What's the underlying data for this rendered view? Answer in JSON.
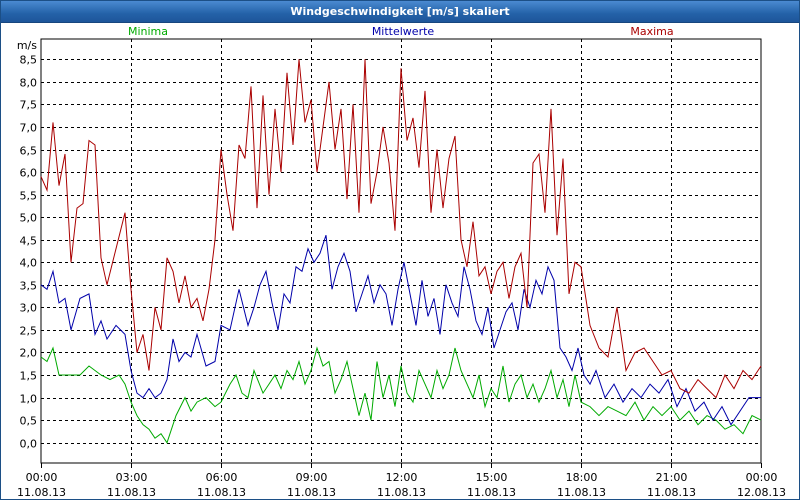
{
  "window": {
    "title": "Windgeschwindigkeit [m/s] skaliert"
  },
  "chart_data": {
    "type": "line",
    "title": "Windgeschwindigkeit [m/s] skaliert",
    "ylabel": "m/s",
    "ylim": [
      -0.45,
      8.95
    ],
    "yticks": [
      0.0,
      0.5,
      1.0,
      1.5,
      2.0,
      2.5,
      3.0,
      3.5,
      4.0,
      4.5,
      5.0,
      5.5,
      6.0,
      6.5,
      7.0,
      7.5,
      8.0,
      8.5
    ],
    "ytick_labels": [
      "0,0",
      "0,5",
      "1,0",
      "1,5",
      "2,0",
      "2,5",
      "3,0",
      "3,5",
      "4,0",
      "4,5",
      "5,0",
      "5,5",
      "6,0",
      "6,5",
      "7,0",
      "7,5",
      "8,0",
      "8,5"
    ],
    "xlim": [
      0,
      24
    ],
    "xticks": [
      0,
      3,
      6,
      9,
      12,
      15,
      18,
      21,
      24
    ],
    "xtick_labels": [
      [
        "00:00",
        "11.08.13"
      ],
      [
        "03:00",
        "11.08.13"
      ],
      [
        "06:00",
        "11.08.13"
      ],
      [
        "09:00",
        "11.08.13"
      ],
      [
        "12:00",
        "11.08.13"
      ],
      [
        "15:00",
        "11.08.13"
      ],
      [
        "18:00",
        "11.08.13"
      ],
      [
        "21:00",
        "11.08.13"
      ],
      [
        "00:00",
        "12.08.13"
      ]
    ],
    "grid": true,
    "legend": "top",
    "series": [
      {
        "name": "Minima",
        "color": "#00aa00",
        "x": [
          0.0,
          0.2,
          0.4,
          0.6,
          0.8,
          1.0,
          1.3,
          1.6,
          2.0,
          2.3,
          2.6,
          2.8,
          3.0,
          3.2,
          3.4,
          3.6,
          3.8,
          4.0,
          4.2,
          4.5,
          4.8,
          5.0,
          5.2,
          5.5,
          5.8,
          6.0,
          6.3,
          6.5,
          6.7,
          6.9,
          7.1,
          7.4,
          7.6,
          7.8,
          8.0,
          8.2,
          8.4,
          8.6,
          8.8,
          9.0,
          9.2,
          9.4,
          9.6,
          9.8,
          10.0,
          10.2,
          10.4,
          10.6,
          10.8,
          11.0,
          11.2,
          11.4,
          11.6,
          11.8,
          12.0,
          12.2,
          12.4,
          12.6,
          12.8,
          13.0,
          13.2,
          13.4,
          13.6,
          13.8,
          14.0,
          14.2,
          14.4,
          14.6,
          14.8,
          15.0,
          15.2,
          15.4,
          15.6,
          15.8,
          16.0,
          16.2,
          16.4,
          16.6,
          16.8,
          17.0,
          17.2,
          17.4,
          17.6,
          17.8,
          18.0,
          18.3,
          18.6,
          18.9,
          19.2,
          19.5,
          19.8,
          20.1,
          20.4,
          20.7,
          21.0,
          21.3,
          21.6,
          21.9,
          22.2,
          22.5,
          22.8,
          23.1,
          23.4,
          23.7,
          24.0
        ],
        "y": [
          1.9,
          1.8,
          2.1,
          1.5,
          1.5,
          1.5,
          1.5,
          1.7,
          1.5,
          1.4,
          1.5,
          1.3,
          0.9,
          0.6,
          0.4,
          0.3,
          0.1,
          0.2,
          0.0,
          0.6,
          1.0,
          0.7,
          0.9,
          1.0,
          0.8,
          0.9,
          1.3,
          1.5,
          1.1,
          1.0,
          1.6,
          1.1,
          1.3,
          1.5,
          1.2,
          1.6,
          1.4,
          1.8,
          1.3,
          1.6,
          2.1,
          1.7,
          1.8,
          1.1,
          1.4,
          1.8,
          1.2,
          0.6,
          1.1,
          0.5,
          1.8,
          1.0,
          1.5,
          0.8,
          1.7,
          1.1,
          0.9,
          1.6,
          1.3,
          1.0,
          1.6,
          1.2,
          1.5,
          2.1,
          1.6,
          1.3,
          1.0,
          1.5,
          0.8,
          1.2,
          1.0,
          1.7,
          0.9,
          1.3,
          1.5,
          1.0,
          1.3,
          0.9,
          1.2,
          1.6,
          1.0,
          1.4,
          0.8,
          1.5,
          0.9,
          0.8,
          0.6,
          0.8,
          0.7,
          0.6,
          0.9,
          0.5,
          0.8,
          0.6,
          0.8,
          0.5,
          0.7,
          0.4,
          0.6,
          0.5,
          0.3,
          0.4,
          0.2,
          0.6,
          0.5
        ],
        "ref": "minima"
      },
      {
        "name": "Mittelwerte",
        "color": "#0000aa",
        "x": [
          0.0,
          0.2,
          0.4,
          0.6,
          0.8,
          1.0,
          1.3,
          1.6,
          1.8,
          2.0,
          2.2,
          2.5,
          2.8,
          3.0,
          3.2,
          3.4,
          3.6,
          3.8,
          4.0,
          4.2,
          4.4,
          4.6,
          4.8,
          5.0,
          5.2,
          5.5,
          5.8,
          6.0,
          6.3,
          6.6,
          6.9,
          7.1,
          7.3,
          7.5,
          7.7,
          7.9,
          8.1,
          8.3,
          8.5,
          8.7,
          8.9,
          9.1,
          9.3,
          9.5,
          9.7,
          9.9,
          10.1,
          10.3,
          10.5,
          10.7,
          10.9,
          11.1,
          11.3,
          11.5,
          11.7,
          11.9,
          12.1,
          12.3,
          12.5,
          12.7,
          12.9,
          13.1,
          13.3,
          13.5,
          13.7,
          13.9,
          14.1,
          14.3,
          14.5,
          14.7,
          14.9,
          15.1,
          15.3,
          15.5,
          15.7,
          15.9,
          16.1,
          16.3,
          16.5,
          16.7,
          16.9,
          17.1,
          17.3,
          17.5,
          17.7,
          17.9,
          18.1,
          18.3,
          18.5,
          18.8,
          19.1,
          19.4,
          19.7,
          20.0,
          20.3,
          20.6,
          20.9,
          21.2,
          21.5,
          21.8,
          22.1,
          22.4,
          22.7,
          23.0,
          23.3,
          23.6,
          24.0
        ],
        "y": [
          3.5,
          3.4,
          3.8,
          3.1,
          3.2,
          2.5,
          3.2,
          3.3,
          2.4,
          2.7,
          2.3,
          2.6,
          2.4,
          1.6,
          1.1,
          1.0,
          1.2,
          1.0,
          1.1,
          1.4,
          2.3,
          1.8,
          2.0,
          1.9,
          2.4,
          1.7,
          1.8,
          2.6,
          2.5,
          3.4,
          2.6,
          3.0,
          3.5,
          3.8,
          3.1,
          2.5,
          3.3,
          3.1,
          3.9,
          3.8,
          4.3,
          4.0,
          4.2,
          4.6,
          3.4,
          3.9,
          4.2,
          3.8,
          2.9,
          3.3,
          3.7,
          3.1,
          3.5,
          3.3,
          2.6,
          3.4,
          4.0,
          3.3,
          2.6,
          3.6,
          2.8,
          3.2,
          2.4,
          3.5,
          3.1,
          2.8,
          3.9,
          3.4,
          2.7,
          2.4,
          3.0,
          2.1,
          2.5,
          2.9,
          3.1,
          2.5,
          3.4,
          3.0,
          3.6,
          3.3,
          3.9,
          3.6,
          2.1,
          1.9,
          1.6,
          2.1,
          1.5,
          1.3,
          1.6,
          1.0,
          1.3,
          0.9,
          1.2,
          1.0,
          1.3,
          1.1,
          1.4,
          0.8,
          1.2,
          0.7,
          0.9,
          0.5,
          0.8,
          0.4,
          0.7,
          1.0,
          1.0
        ],
        "ref": "mittelwerte"
      },
      {
        "name": "Maxima",
        "color": "#aa0000",
        "x": [
          0.0,
          0.2,
          0.4,
          0.6,
          0.8,
          1.0,
          1.2,
          1.4,
          1.6,
          1.8,
          2.0,
          2.2,
          2.5,
          2.8,
          3.0,
          3.2,
          3.4,
          3.6,
          3.8,
          4.0,
          4.2,
          4.4,
          4.6,
          4.8,
          5.0,
          5.2,
          5.4,
          5.6,
          5.8,
          6.0,
          6.2,
          6.4,
          6.6,
          6.8,
          7.0,
          7.2,
          7.4,
          7.6,
          7.8,
          8.0,
          8.2,
          8.4,
          8.6,
          8.8,
          9.0,
          9.2,
          9.4,
          9.6,
          9.8,
          10.0,
          10.2,
          10.4,
          10.6,
          10.8,
          11.0,
          11.2,
          11.4,
          11.6,
          11.8,
          12.0,
          12.2,
          12.4,
          12.6,
          12.8,
          13.0,
          13.2,
          13.4,
          13.6,
          13.8,
          14.0,
          14.2,
          14.4,
          14.6,
          14.8,
          15.0,
          15.2,
          15.4,
          15.6,
          15.8,
          16.0,
          16.2,
          16.4,
          16.6,
          16.8,
          17.0,
          17.2,
          17.4,
          17.6,
          17.8,
          18.0,
          18.3,
          18.6,
          18.9,
          19.2,
          19.5,
          19.8,
          20.1,
          20.4,
          20.7,
          21.0,
          21.3,
          21.6,
          21.9,
          22.2,
          22.5,
          22.8,
          23.1,
          23.4,
          23.7,
          24.0
        ],
        "y": [
          5.9,
          5.6,
          7.1,
          5.7,
          6.4,
          4.0,
          5.2,
          5.3,
          6.7,
          6.6,
          4.1,
          3.5,
          4.3,
          5.1,
          3.4,
          2.0,
          2.4,
          1.6,
          3.0,
          2.5,
          4.1,
          3.8,
          3.1,
          3.7,
          3.0,
          3.2,
          2.7,
          3.4,
          4.5,
          6.5,
          5.5,
          4.7,
          6.6,
          6.3,
          7.9,
          5.2,
          7.7,
          5.5,
          7.4,
          6.0,
          8.2,
          6.6,
          8.5,
          7.1,
          7.6,
          6.0,
          7.0,
          8.0,
          6.5,
          7.4,
          5.4,
          7.5,
          5.1,
          8.5,
          5.3,
          6.0,
          7.0,
          6.2,
          4.7,
          8.3,
          6.7,
          7.2,
          6.1,
          7.8,
          5.1,
          6.5,
          5.2,
          6.3,
          6.8,
          4.5,
          3.9,
          4.9,
          3.7,
          3.9,
          3.3,
          3.8,
          4.0,
          3.2,
          3.9,
          4.2,
          3.0,
          6.2,
          6.4,
          5.1,
          7.4,
          4.6,
          6.3,
          3.3,
          4.0,
          3.9,
          2.6,
          2.1,
          1.9,
          3.0,
          1.6,
          2.0,
          2.1,
          1.8,
          1.5,
          1.6,
          1.2,
          1.1,
          1.4,
          1.2,
          1.0,
          1.5,
          1.2,
          1.6,
          1.4,
          1.7
        ],
        "ref": "maxima"
      }
    ]
  }
}
